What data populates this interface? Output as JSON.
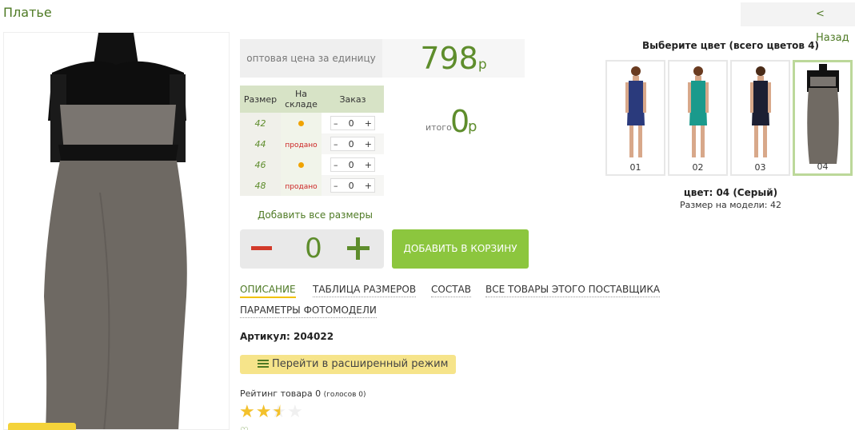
{
  "page": {
    "title": "Платье",
    "back_label": "< Назад"
  },
  "price": {
    "label": "оптовая цена за единицу",
    "value": "798",
    "currency": "р"
  },
  "size_table": {
    "headers": [
      "Размер",
      "На складе",
      "Заказ"
    ],
    "rows": [
      {
        "size": "42",
        "stock": "dot",
        "qty": "0"
      },
      {
        "size": "44",
        "stock": "продано",
        "qty": "0"
      },
      {
        "size": "46",
        "stock": "dot",
        "qty": "0"
      },
      {
        "size": "48",
        "stock": "продано",
        "qty": "0"
      }
    ],
    "minus": "–",
    "plus": "+"
  },
  "total": {
    "label": "итого",
    "value": "0",
    "currency": "р"
  },
  "add_all_sizes": "Добавить все размеры",
  "quantity": {
    "value": "0"
  },
  "add_to_cart": "ДОБАВИТЬ В КОРЗИНУ",
  "tabs": [
    "ОПИСАНИЕ",
    "ТАБЛИЦА РАЗМЕРОВ",
    "СОСТАВ",
    "ВСЕ ТОВАРЫ ЭТОГО ПОСТАВЩИКА",
    "ПАРАМЕТРЫ ФОТОМОДЕЛИ"
  ],
  "sku": {
    "label": "Артикул:",
    "value": "204022"
  },
  "extended_mode": "Перейти в расширенный режим",
  "rating": {
    "label": "Рейтинг товара",
    "value": "0",
    "votes": "(голосов 0)",
    "stars_filled": 2.5,
    "stars_total": 5
  },
  "colors": {
    "title": "Выберите цвет (всего цветов 4)",
    "items": [
      {
        "num": "01",
        "color": "#2a3a7c"
      },
      {
        "num": "02",
        "color": "#1a9a8c"
      },
      {
        "num": "03",
        "color": "#1c1f33"
      },
      {
        "num": "04",
        "color": "#706a63"
      }
    ],
    "selected_info": "цвет: 04 (Серый)",
    "model_size": "Размер на модели: 42"
  },
  "colors_accent": {
    "green": "#5e8d2c",
    "button": "#8cc63e",
    "yellow": "#f6e48a"
  }
}
